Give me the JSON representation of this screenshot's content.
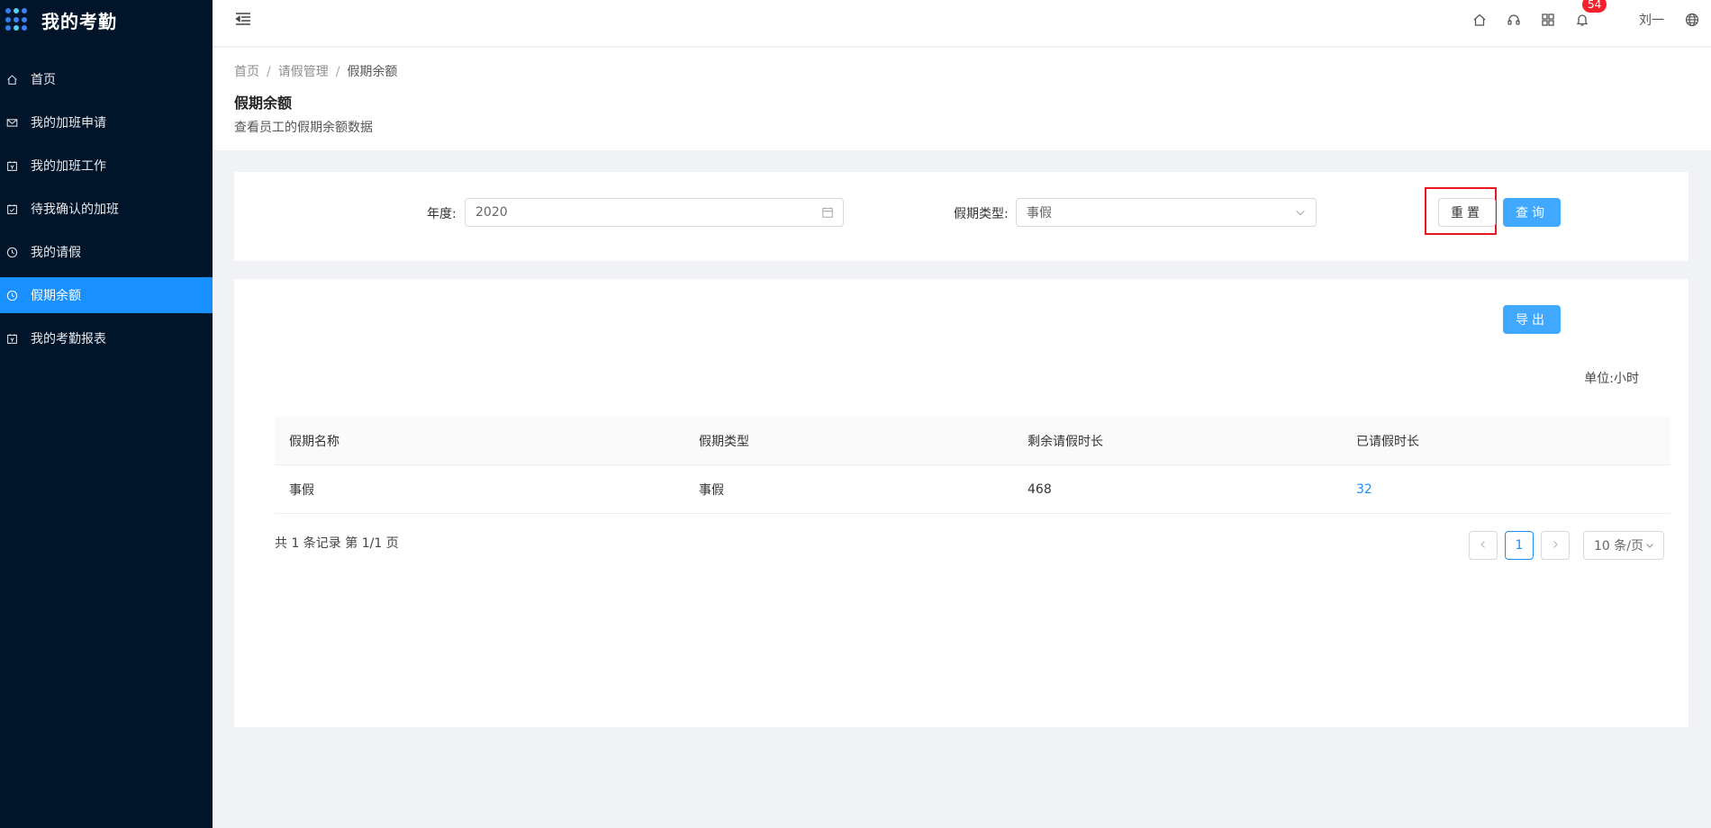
{
  "app": {
    "title": "我的考勤"
  },
  "sidebar": {
    "items": [
      {
        "label": "首页",
        "icon": "home-icon"
      },
      {
        "label": "我的加班申请",
        "icon": "mail-icon"
      },
      {
        "label": "我的加班工作",
        "icon": "calendar-icon"
      },
      {
        "label": "待我确认的加班",
        "icon": "check-square-icon"
      },
      {
        "label": "我的请假",
        "icon": "clock-icon"
      },
      {
        "label": "假期余额",
        "icon": "clock-icon",
        "active": true
      },
      {
        "label": "我的考勤报表",
        "icon": "calendar-icon"
      }
    ]
  },
  "header": {
    "notification_count": "54",
    "username": "刘一"
  },
  "breadcrumb": [
    "首页",
    "请假管理",
    "假期余额"
  ],
  "page": {
    "title": "假期余额",
    "description": "查看员工的假期余额数据"
  },
  "filter": {
    "year_label": "年度:",
    "year_value": "2020",
    "type_label": "假期类型:",
    "type_value": "事假",
    "reset_label": "重置",
    "query_label": "查询"
  },
  "table": {
    "export_label": "导出",
    "unit": "单位:小时",
    "columns": [
      "假期名称",
      "假期类型",
      "剩余请假时长",
      "已请假时长"
    ],
    "rows": [
      {
        "name": "事假",
        "type": "事假",
        "remaining": "468",
        "used": "32"
      }
    ],
    "summary": "共 1 条记录 第 1/1 页",
    "current_page": "1",
    "page_size": "10 条/页"
  },
  "colors": {
    "sidebar_bg": "#001529",
    "primary": "#1890ff",
    "highlight": "#e8161d"
  }
}
